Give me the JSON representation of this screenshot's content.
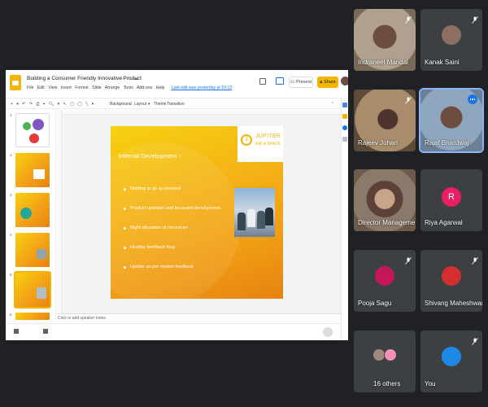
{
  "slides_app": {
    "doc_title": "Building a Consumer Friendly Innovative Product",
    "menu": [
      "File",
      "Edit",
      "View",
      "Insert",
      "Format",
      "Slide",
      "Arrange",
      "Tools",
      "Add-ons",
      "Help"
    ],
    "last_edit": "Last edit was yesterday at 10:13",
    "present_label": "Present",
    "share_label": "Share",
    "toolbar_items": [
      "Background",
      "Layout",
      "Theme",
      "Transition"
    ],
    "thumb_numbers": [
      "1",
      "2",
      "3",
      "4",
      "5",
      "6"
    ],
    "speaker_notes_placeholder": "Click to add speaker notes",
    "accent": "#f4b400"
  },
  "slide": {
    "logo_name": "JUPITER",
    "logo_sub": "AIR & SPACE",
    "heading": "Internal Development -",
    "bullets": [
      "Nothing to go as planned",
      "Product updation and focussed development",
      "Right allocation of resources",
      "Healthy feedback loop",
      "Update as per market feedback"
    ]
  },
  "participants": [
    {
      "name": "Indraneel Mandal"
    },
    {
      "name": "Kanak Saini"
    },
    {
      "name": "Rajeev Johari"
    },
    {
      "name": "Rajat Bhardwaj"
    },
    {
      "name": "Director Manageme..."
    },
    {
      "name": "Riya Agarwal",
      "initial": "R"
    },
    {
      "name": "Pooja Sagu"
    },
    {
      "name": "Shivang Maheshwari"
    },
    {
      "name": "16 others"
    },
    {
      "name": "You"
    }
  ]
}
